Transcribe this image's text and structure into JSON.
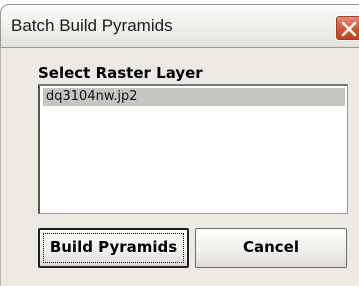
{
  "window": {
    "title": "Batch Build Pyramids",
    "close_icon": "close-x-icon"
  },
  "form": {
    "section_label": "Select Raster Layer",
    "list_items": [
      "dq3104nw.jp2"
    ],
    "selected_index": 0
  },
  "buttons": {
    "build_label": "Build Pyramids",
    "cancel_label": "Cancel"
  },
  "colors": {
    "close_button": "#d3542f",
    "selection": "#c6c5c0",
    "dialog_background": "#eceae3"
  }
}
